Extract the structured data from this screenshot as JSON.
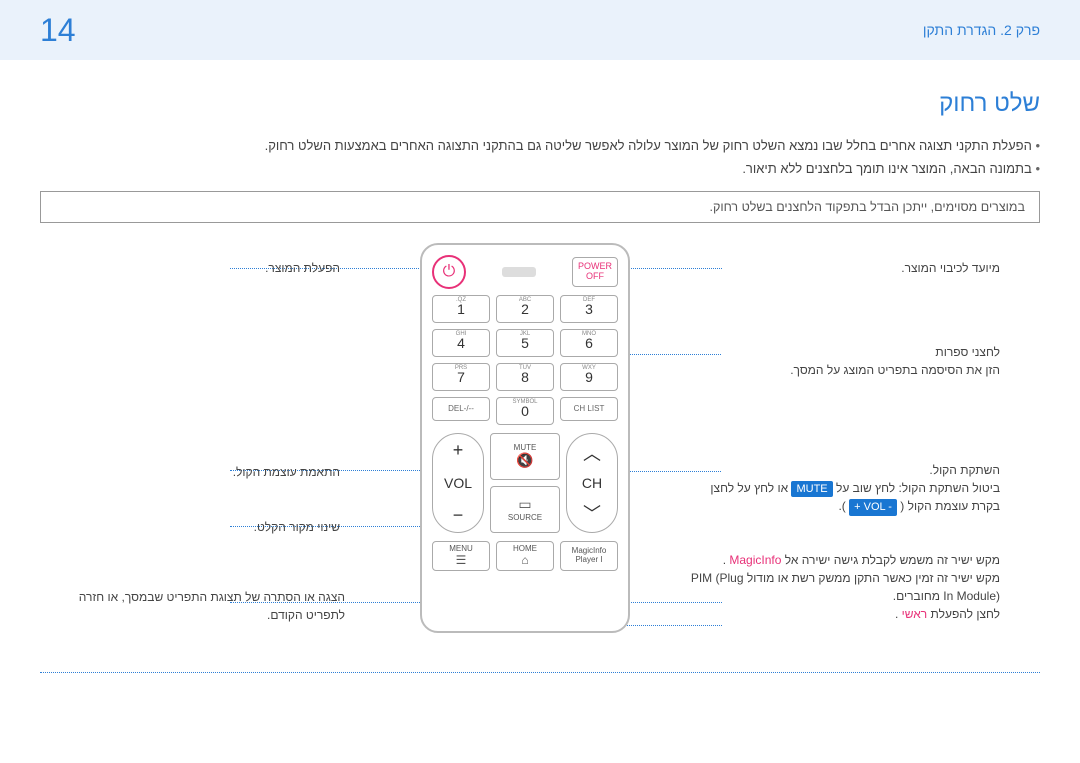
{
  "header": {
    "page_number": "14",
    "chapter": "פרק 2. הגדרת התקן"
  },
  "section_title": "שלט רחוק",
  "intro_bullets": [
    "הפעלת התקני תצוגה אחרים בחלל שבו נמצא השלט רחוק של המוצר עלולה לאפשר שליטה גם בהתקני התצוגה האחרים באמצעות השלט רחוק.",
    "בתמונה הבאה, המוצר אינו תומך בלחצנים ללא תיאור."
  ],
  "note": "במוצרים מסוימים, ייתכן הבדל בתפקוד הלחצנים בשלט רחוק.",
  "remote": {
    "power_top": "POWER",
    "power_bottom": "OFF",
    "keys": {
      "1": {
        "num": "1",
        "sub": ".QZ"
      },
      "2": {
        "num": "2",
        "sub": "ABC"
      },
      "3": {
        "num": "3",
        "sub": "DEF"
      },
      "4": {
        "num": "4",
        "sub": "GHI"
      },
      "5": {
        "num": "5",
        "sub": "JKL"
      },
      "6": {
        "num": "6",
        "sub": "MNO"
      },
      "7": {
        "num": "7",
        "sub": "PRS"
      },
      "8": {
        "num": "8",
        "sub": "TUV"
      },
      "9": {
        "num": "9",
        "sub": "WXY"
      },
      "0": {
        "num": "0",
        "sub": "SYMBOL"
      }
    },
    "del": "DEL-/--",
    "chlist": "CH LIST",
    "vol": "VOL",
    "ch": "CH",
    "mute": "MUTE",
    "source": "SOURCE",
    "menu": "MENU",
    "home": "HOME",
    "magic1": "MagicInfo",
    "magic2": "Player I"
  },
  "labels": {
    "left": {
      "power_on": "הפעלת המוצר.",
      "vol_adj": "התאמת עוצמת הקול.",
      "source": "שינוי מקור הקלט.",
      "menu": "הצגה או הסתרה של תצוגת התפריט שבמסך, או חזרה לתפריט הקודם."
    },
    "right": {
      "power_off": "מיועד לכיבוי המוצר.",
      "numbers_title": "לחצני ספרות",
      "numbers_body": "הזן את הסיסמה בתפריט המוצג על המסך.",
      "mute_title": "השתקת הקול.",
      "mute_body_pre": "ביטול השתקת הקול: לחץ שוב על ",
      "mute_pill": "MUTE",
      "mute_body_mid": " או לחץ על לחצן בקרת עוצמת הקול (",
      "vol_pill": "+ VOL -",
      "mute_body_post": ").",
      "magic_line1_pre": "מקש ישיר זה משמש לקבלת גישה ישירה אל ",
      "magic_word": "MagicInfo",
      "magic_line1_post": ".",
      "magic_line2": "מקש ישיר זה זמין כאשר התקן ממשק רשת או מודול PIM (Plug In Module) מחוברים.",
      "home_pre": "לחצן להפעלת ",
      "home_pill": "ראשי",
      "home_post": "."
    }
  }
}
